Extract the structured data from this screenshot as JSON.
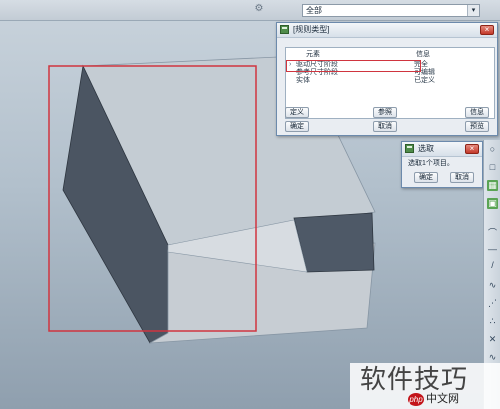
{
  "topbar": {
    "filter_value": "全部",
    "filter_arrow": "▾",
    "gear_icon": "gear-icon"
  },
  "constraint_dialog": {
    "title": "[规则类型]",
    "close_label": "×",
    "columns": {
      "element": "元素",
      "state": "信息"
    },
    "rows": [
      {
        "marker": "›",
        "element": "驱动尺寸阶段",
        "state": "完全"
      },
      {
        "element": "参考尺寸阶段",
        "state": "可编辑"
      },
      {
        "element": "实体",
        "state": "已定义"
      }
    ],
    "buttons": {
      "define": "定义",
      "reference": "参照",
      "info": "信息",
      "ok": "确定",
      "cancel": "取消",
      "preview": "预览"
    }
  },
  "select_dialog": {
    "title": "选取",
    "prompt": "选取1个项目。",
    "ok": "确定",
    "cancel": "取消"
  },
  "right_toolbar": {
    "tools": [
      "○",
      "□",
      "⌒",
      "—",
      "/",
      "∿",
      "⋰",
      "∴",
      "✕",
      "∿"
    ]
  },
  "watermark": {
    "text": "软件技巧",
    "logo": "php",
    "site": "中文网"
  },
  "colors": {
    "highlight_red": "#d0353f",
    "viewport_top": "#c9d3dc",
    "viewport_bottom": "#8f9fae"
  }
}
